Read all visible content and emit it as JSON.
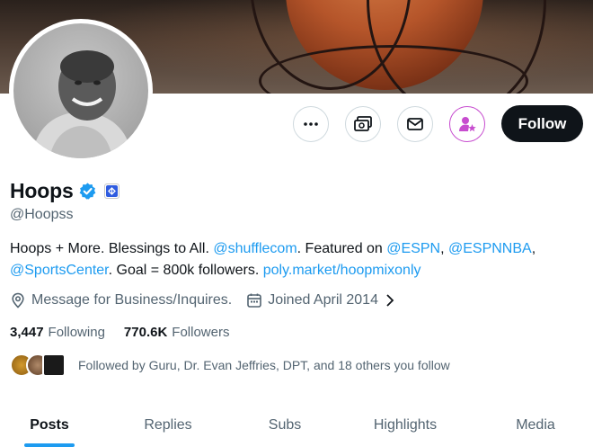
{
  "profile": {
    "name": "Hoops",
    "handle": "@Hoopss",
    "bio": {
      "part1": "Hoops + More. Blessings to All. ",
      "mention1": "@shufflecom",
      "part2": ". Featured on ",
      "mention2": "@ESPN",
      "sep1": ", ",
      "mention3": "@ESPNNBA",
      "sep2": ", ",
      "mention4": "@SportsCenter",
      "part3": ". Goal = 800k followers. ",
      "link": "poly.market/hoopmixonly"
    },
    "location": "Message for Business/Inquires.",
    "joined": "Joined April 2014"
  },
  "actions": {
    "follow_label": "Follow"
  },
  "stats": {
    "following_count": "3,447",
    "following_label": "Following",
    "followers_count": "770.6K",
    "followers_label": "Followers"
  },
  "followed_by": "Followed by Guru, Dr. Evan Jeffries, DPT, and 18 others you follow",
  "tabs": [
    {
      "label": "Posts"
    },
    {
      "label": "Replies"
    },
    {
      "label": "Subs"
    },
    {
      "label": "Highlights"
    },
    {
      "label": "Media"
    }
  ],
  "icons": {
    "more": "more-icon",
    "monetization": "money-icon",
    "message": "envelope-icon",
    "subscribe": "subscribe-person-star-icon",
    "verified": "verified-badge-icon",
    "affiliate": "affiliate-badge-icon",
    "location": "location-pin-icon",
    "calendar": "calendar-icon",
    "chevron": "chevron-right-icon"
  },
  "colors": {
    "accent": "#1d9bf0",
    "text": "#0f1419",
    "muted": "#536471",
    "subscribe": "#c74ccf"
  }
}
